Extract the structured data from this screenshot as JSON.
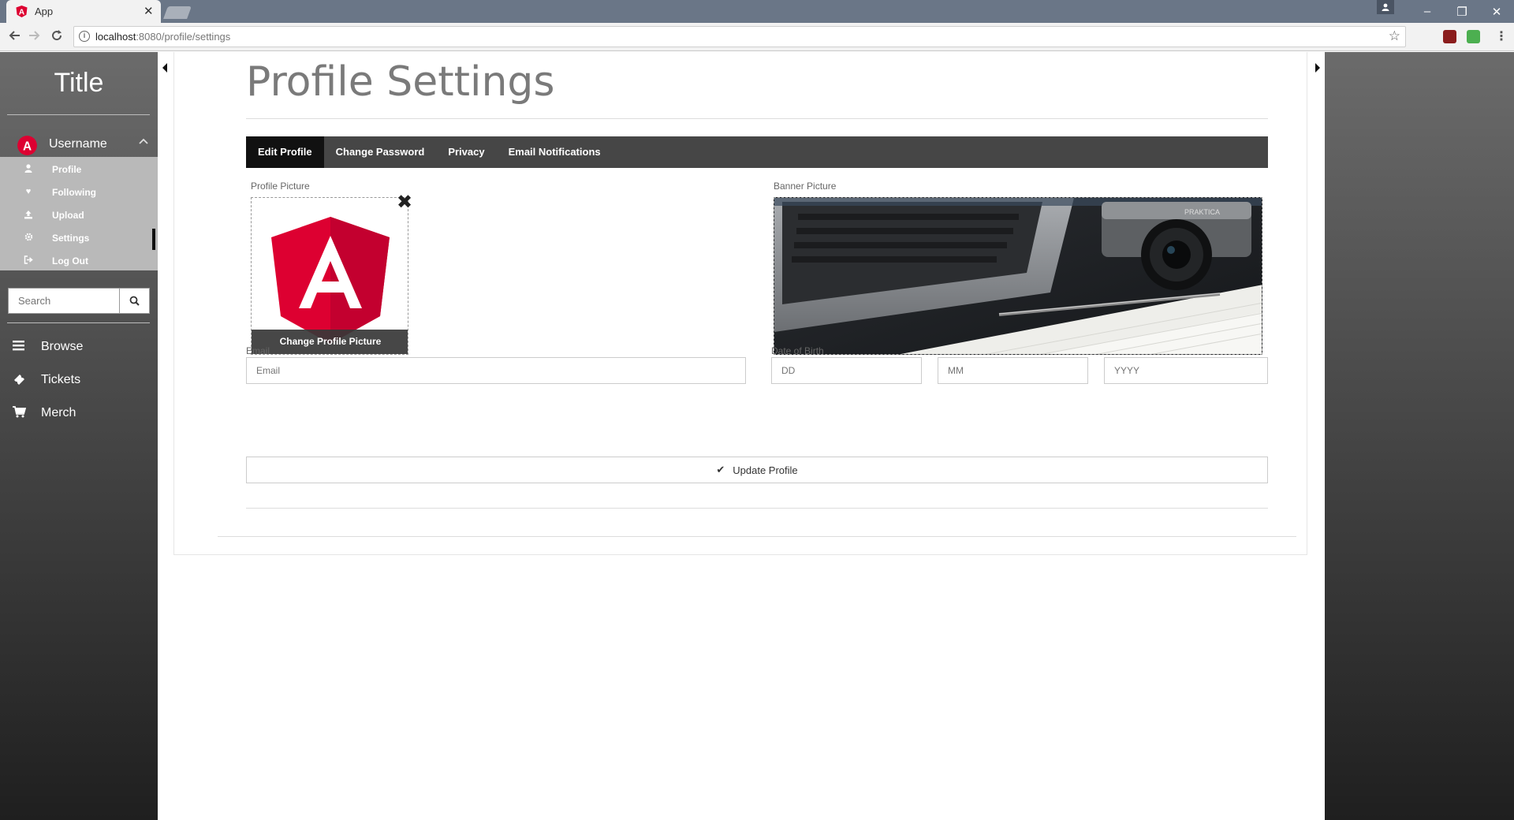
{
  "browser": {
    "tab_title": "App",
    "tab_close": "✕",
    "url_host": "localhost",
    "url_rest": ":8080/profile/settings",
    "window_controls": [
      "–",
      "❐",
      "✕"
    ]
  },
  "sidebar": {
    "title": "Title",
    "username": "Username",
    "avatar_letter": "A",
    "submenu": [
      {
        "label": "Profile",
        "icon": "user-icon"
      },
      {
        "label": "Following",
        "icon": "heart-icon"
      },
      {
        "label": "Upload",
        "icon": "upload-icon"
      },
      {
        "label": "Settings",
        "icon": "gear-icon",
        "active": true
      },
      {
        "label": "Log Out",
        "icon": "logout-icon"
      }
    ],
    "search_placeholder": "Search",
    "main_nav": [
      {
        "label": "Browse",
        "icon": "bars-icon"
      },
      {
        "label": "Tickets",
        "icon": "ticket-icon"
      },
      {
        "label": "Merch",
        "icon": "cart-icon"
      }
    ]
  },
  "page": {
    "title": "Profile Settings",
    "tabs": [
      "Edit Profile",
      "Change Password",
      "Privacy",
      "Email Notifications"
    ],
    "active_tab": "Edit Profile",
    "profile_picture_label": "Profile Picture",
    "change_picture_label": "Change Profile Picture",
    "remove_picture": "✖",
    "banner_picture_label": "Banner Picture",
    "email_label": "Email",
    "email_placeholder": "Email",
    "email_value": "",
    "dob_label": "Date of Birth",
    "dob_day_placeholder": "DD",
    "dob_month_placeholder": "MM",
    "dob_year_placeholder": "YYYY",
    "update_button": "Update Profile",
    "update_icon": "✔"
  },
  "colors": {
    "brand_red": "#dd0031",
    "tab_bar": "#464646",
    "tab_active": "#111111"
  }
}
